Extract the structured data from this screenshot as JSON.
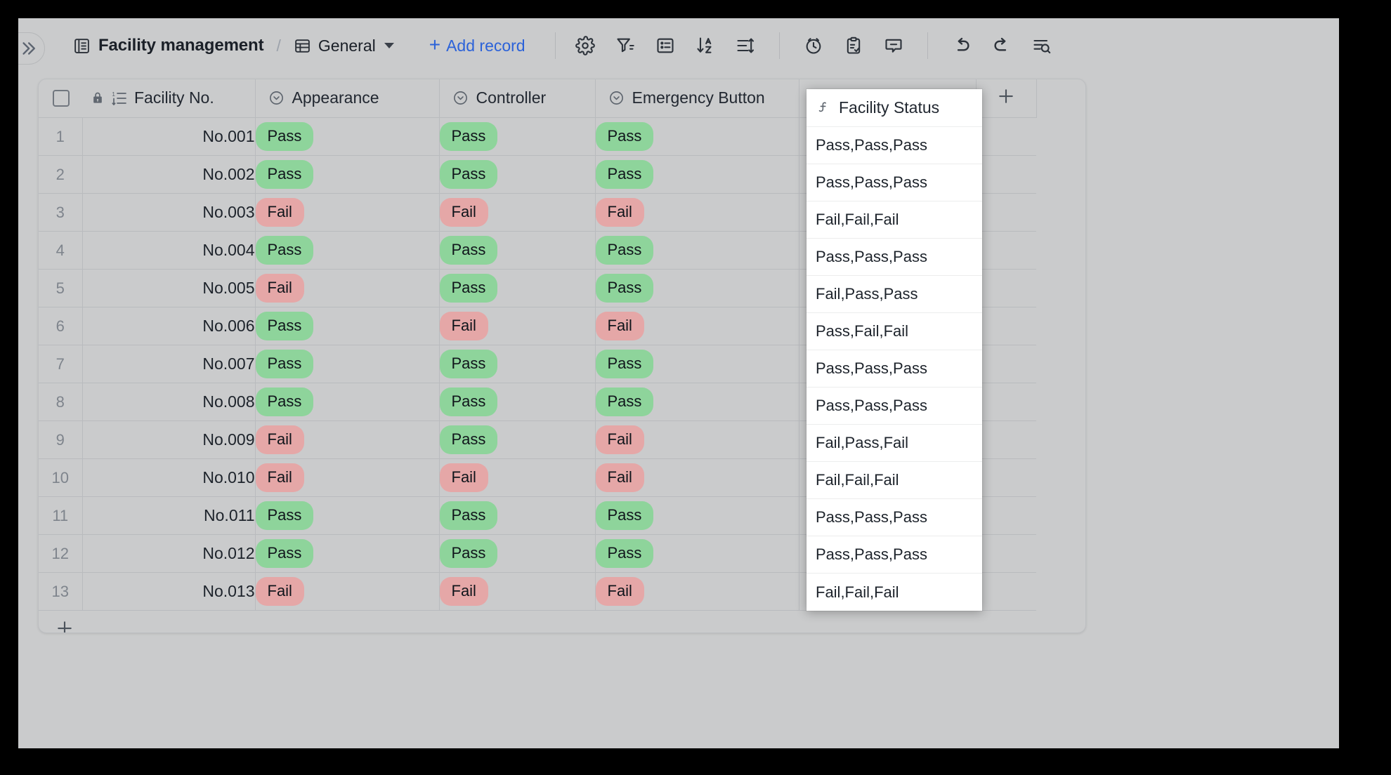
{
  "toolbar": {
    "collapse_icon": "double-chevron-right-icon",
    "breadcrumb": {
      "table_icon": "table-icon",
      "table_name": "Facility management",
      "separator": "/",
      "view_icon": "grid-view-icon",
      "view_name": "General"
    },
    "add_record_plus": "+",
    "add_record_label": "Add record",
    "tools": [
      {
        "name": "gear-icon",
        "title": "Settings"
      },
      {
        "name": "filter-icon",
        "title": "Filter"
      },
      {
        "name": "group-icon",
        "title": "Group"
      },
      {
        "name": "sort-az-icon",
        "title": "Sort"
      },
      {
        "name": "row-height-icon",
        "title": "Row height"
      }
    ],
    "tools2": [
      {
        "name": "clock-icon",
        "title": "History"
      },
      {
        "name": "clipboard-check-icon",
        "title": "Tasks"
      },
      {
        "name": "comment-icon",
        "title": "Comments"
      }
    ],
    "tools3": [
      {
        "name": "undo-icon",
        "title": "Undo"
      },
      {
        "name": "redo-icon",
        "title": "Redo"
      },
      {
        "name": "search-rows-icon",
        "title": "Search"
      }
    ]
  },
  "grid": {
    "select_all_checkbox": "",
    "add_column_label": "+",
    "add_row_label": "+",
    "columns": [
      {
        "key": "rownum",
        "label": "",
        "icon": ""
      },
      {
        "key": "facility_no",
        "label": "Facility No.",
        "icon": "autonumber-icon",
        "locked_icon": "lock-icon"
      },
      {
        "key": "appearance",
        "label": "Appearance",
        "icon": "single-select-icon"
      },
      {
        "key": "controller",
        "label": "Controller",
        "icon": "single-select-icon"
      },
      {
        "key": "emergency",
        "label": "Emergency Button",
        "icon": "single-select-icon"
      },
      {
        "key": "status",
        "label": "Facility Status",
        "icon": "formula-icon"
      }
    ],
    "rows": [
      {
        "num": "1",
        "facility_no": "No.001",
        "appearance": "Pass",
        "controller": "Pass",
        "emergency": "Pass",
        "status": "Pass,Pass,Pass"
      },
      {
        "num": "2",
        "facility_no": "No.002",
        "appearance": "Pass",
        "controller": "Pass",
        "emergency": "Pass",
        "status": "Pass,Pass,Pass"
      },
      {
        "num": "3",
        "facility_no": "No.003",
        "appearance": "Fail",
        "controller": "Fail",
        "emergency": "Fail",
        "status": "Fail,Fail,Fail"
      },
      {
        "num": "4",
        "facility_no": "No.004",
        "appearance": "Pass",
        "controller": "Pass",
        "emergency": "Pass",
        "status": "Pass,Pass,Pass"
      },
      {
        "num": "5",
        "facility_no": "No.005",
        "appearance": "Fail",
        "controller": "Pass",
        "emergency": "Pass",
        "status": "Fail,Pass,Pass"
      },
      {
        "num": "6",
        "facility_no": "No.006",
        "appearance": "Pass",
        "controller": "Fail",
        "emergency": "Fail",
        "status": "Pass,Fail,Fail"
      },
      {
        "num": "7",
        "facility_no": "No.007",
        "appearance": "Pass",
        "controller": "Pass",
        "emergency": "Pass",
        "status": "Pass,Pass,Pass"
      },
      {
        "num": "8",
        "facility_no": "No.008",
        "appearance": "Pass",
        "controller": "Pass",
        "emergency": "Pass",
        "status": "Pass,Pass,Pass"
      },
      {
        "num": "9",
        "facility_no": "No.009",
        "appearance": "Fail",
        "controller": "Pass",
        "emergency": "Fail",
        "status": "Fail,Pass,Fail"
      },
      {
        "num": "10",
        "facility_no": "No.010",
        "appearance": "Fail",
        "controller": "Fail",
        "emergency": "Fail",
        "status": "Fail,Fail,Fail"
      },
      {
        "num": "11",
        "facility_no": "No.011",
        "appearance": "Pass",
        "controller": "Pass",
        "emergency": "Pass",
        "status": "Pass,Pass,Pass"
      },
      {
        "num": "12",
        "facility_no": "No.012",
        "appearance": "Pass",
        "controller": "Pass",
        "emergency": "Pass",
        "status": "Pass,Pass,Pass"
      },
      {
        "num": "13",
        "facility_no": "No.013",
        "appearance": "Fail",
        "controller": "Fail",
        "emergency": "Fail",
        "status": "Fail,Fail,Fail"
      }
    ]
  },
  "colors": {
    "app_background": "#cacbcc",
    "accent_link": "#2b62d9",
    "badge_pass_bg": "#8ed49b",
    "badge_fail_bg": "#e5a7a7",
    "overlay_bg": "#ffffff",
    "text_primary": "#1d232b",
    "border": "#b9bbbe"
  }
}
